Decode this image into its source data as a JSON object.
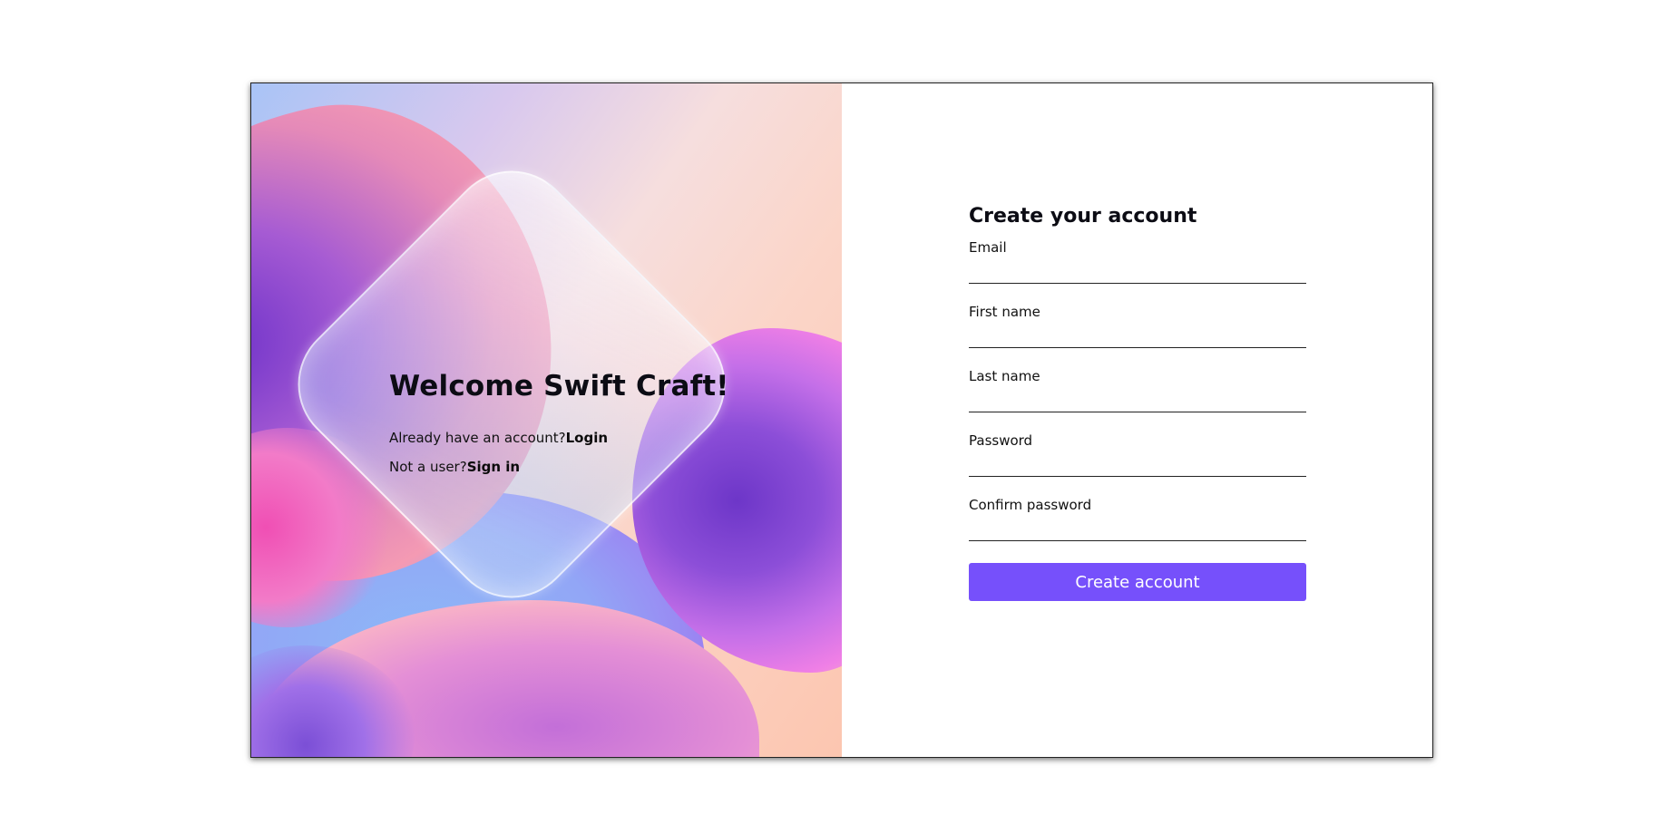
{
  "welcome": {
    "title": "Welcome Swift Craft!",
    "login_prompt": "Already have an account?",
    "login_link": "Login",
    "signin_prompt": "Not a user?",
    "signin_link": "Sign in"
  },
  "form": {
    "title": "Create your account",
    "fields": [
      {
        "label": "Email",
        "value": ""
      },
      {
        "label": "First name",
        "value": ""
      },
      {
        "label": "Last name",
        "value": ""
      },
      {
        "label": "Password",
        "value": ""
      },
      {
        "label": "Confirm password",
        "value": ""
      }
    ],
    "submit_label": "Create account"
  },
  "colors": {
    "accent": "#7650fb",
    "text": "#0c0c14"
  }
}
